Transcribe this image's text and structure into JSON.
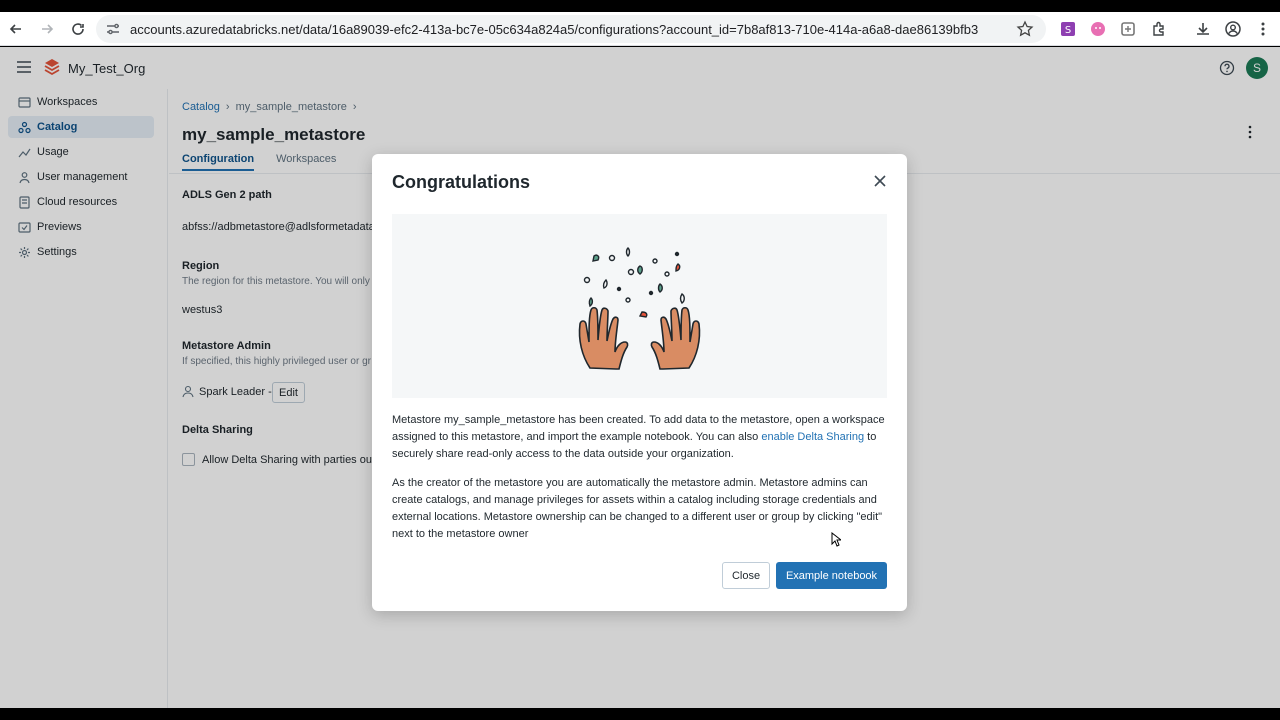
{
  "browser": {
    "url": "accounts.azuredatabricks.net/data/16a89039-efc2-413a-bc7e-05c634a824a5/configurations?account_id=7b8af813-710e-414a-a6a8-dae86139bfb3"
  },
  "header": {
    "org_name": "My_Test_Org",
    "avatar_letter": "S"
  },
  "sidebar": {
    "items": [
      {
        "label": "Workspaces",
        "icon": "workspaces-icon"
      },
      {
        "label": "Catalog",
        "icon": "catalog-icon",
        "active": true
      },
      {
        "label": "Usage",
        "icon": "usage-icon"
      },
      {
        "label": "User management",
        "icon": "user-management-icon"
      },
      {
        "label": "Cloud resources",
        "icon": "cloud-resources-icon"
      },
      {
        "label": "Previews",
        "icon": "previews-icon"
      },
      {
        "label": "Settings",
        "icon": "gear-icon"
      }
    ]
  },
  "main": {
    "breadcrumb": [
      "Catalog",
      "my_sample_metastore"
    ],
    "title": "my_sample_metastore",
    "tabs": [
      "Configuration",
      "Workspaces"
    ],
    "adls_label": "ADLS Gen 2 path",
    "adls_value": "abfss://adbmetastore@adlsformetadata",
    "region_label": "Region",
    "region_desc": "The region for this metastore. You will only",
    "region_value": "westus3",
    "admin_label": "Metastore Admin",
    "admin_desc": "If specified, this highly privileged user or gr",
    "admin_value": "Spark Leader -",
    "edit_label": "Edit",
    "delta_label": "Delta Sharing",
    "delta_checkbox_label": "Allow Delta Sharing with parties out"
  },
  "modal": {
    "title": "Congratulations",
    "p1_before": "Metastore my_sample_metastore has been created. To add data to the metastore, open a workspace assigned to this metastore, and import the example notebook. You can also ",
    "p1_link": "enable Delta Sharing",
    "p1_after": " to securely share read-only access to the data outside your organization.",
    "p2": "As the creator of the metastore you are automatically the metastore admin. Metastore admins can create catalogs, and manage privileges for assets within a catalog including storage credentials and external locations. Metastore ownership can be changed to a different user or group by clicking \"edit\" next to the metastore owner",
    "close_label": "Close",
    "primary_label": "Example notebook"
  },
  "colors": {
    "accent": "#2272b4",
    "active_nav_bg": "#e6eef7",
    "avatar": "#1b7a56"
  }
}
